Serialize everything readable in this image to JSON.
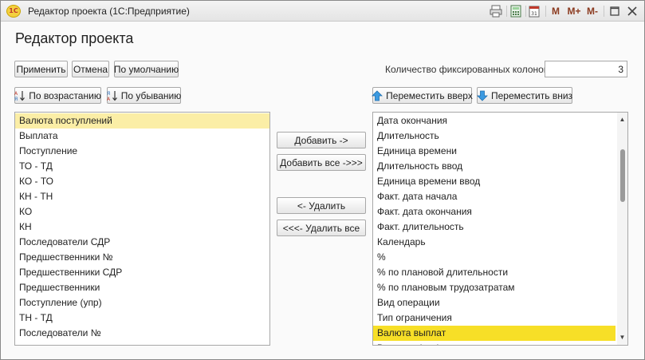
{
  "window": {
    "title": "Редактор проекта  (1С:Предприятие)",
    "logo": "1С"
  },
  "titlebar_buttons": {
    "m": "M",
    "m_plus": "M+",
    "m_minus": "M-"
  },
  "heading": "Редактор проекта",
  "toolbar": {
    "apply_label": "Применить",
    "cancel_label": "Отмена",
    "default_label": "По умолчанию"
  },
  "fixed_columns": {
    "label": "Количество фиксированных колонок:",
    "value": "3"
  },
  "sort": {
    "asc_label": "По возрастанию",
    "desc_label": "По убыванию"
  },
  "move": {
    "up_label": "Переместить вверх",
    "down_label": "Переместить вниз"
  },
  "actions": {
    "add_label": "Добавить ->",
    "add_all_label": "Добавить все ->>>",
    "remove_label": "<- Удалить",
    "remove_all_label": "<<<- Удалить все"
  },
  "left_list": {
    "selected_index": 0,
    "items": [
      "Валюта поступлений",
      "Выплата",
      "Поступление",
      "ТО - ТД",
      "КО - ТО",
      "КН - ТН",
      "КО",
      "КН",
      "Последователи СДР",
      "Предшественники №",
      "Предшественники СДР",
      "Предшественники",
      "Поступление (упр)",
      "ТН - ТД",
      "Последователи №"
    ]
  },
  "right_list": {
    "selected_index": 14,
    "items": [
      "Дата окончания",
      "Длительность",
      "Единица времени",
      "Длительность ввод",
      "Единица времени ввод",
      "Факт. дата начала",
      "Факт. дата окончания",
      "Факт. длительность",
      "Календарь",
      "%",
      "% по плановой длительности",
      "% по плановым трудозатратам",
      "Вид операции",
      "Тип ограничения",
      "Валюта выплат",
      "Выплата (упр)"
    ]
  },
  "colors": {
    "left_selection": "#fbeea6",
    "right_selection": "#f7df27",
    "move_arrow": "#3b9ae1"
  }
}
